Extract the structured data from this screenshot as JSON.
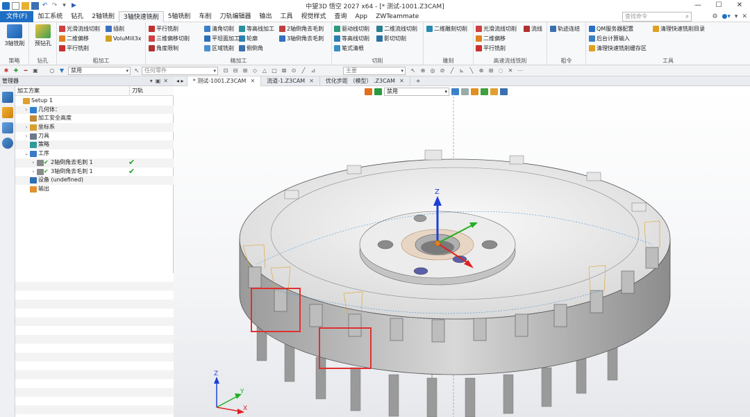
{
  "app": {
    "title": "中望3D 悟空 2027 x64  - [* 测试-1001.Z3CAM]",
    "window_controls": [
      "—",
      "☐",
      "✕"
    ]
  },
  "menu": {
    "tabs": [
      "文件(F)",
      "加工系统",
      "钻孔",
      "2轴铣削",
      "3轴快速铣削",
      "5轴铣削",
      "车削",
      "刀轨编辑器",
      "输出",
      "工具",
      "视觉样式",
      "查询",
      "App",
      "ZWTeammate"
    ],
    "active_tab": "3轴快速铣削",
    "search_placeholder": "查找命令"
  },
  "ribbon": {
    "groups": [
      {
        "label": "策略",
        "items": [
          "3轴铣削"
        ]
      },
      {
        "label": "钻孔",
        "items": [
          "预钻孔"
        ]
      },
      {
        "label": "粗加工",
        "items": [
          "光滑流线切削",
          "二维偏移",
          "平行铣削",
          "插削",
          "VoluMill3x"
        ]
      },
      {
        "label": "精加工",
        "items": [
          "平行铣削",
          "三维偏移切削",
          "角度限制",
          "清角切削",
          "平坦面加工",
          "区域铣削",
          "等高线加工",
          "轮廓",
          "侧倒角",
          "2轴倒角去毛刺",
          "3轴倒角去毛刺"
        ]
      },
      {
        "label": "切削",
        "items": [
          "驱动线切削",
          "等高线切削",
          "笔式清根",
          "二维流线切削",
          "影切切削"
        ]
      },
      {
        "label": "雕刻",
        "items": [
          "二维雕刻切削"
        ]
      },
      {
        "label": "高速流线铣削",
        "items": [
          "光滑流线切削",
          "二维偏移",
          "平行铣削",
          "流线"
        ]
      },
      {
        "label": "粗令",
        "items": [
          "轨迹连结"
        ]
      },
      {
        "label": "工具",
        "items": [
          "QM服务器配置",
          "后台计算输入",
          "清理快速铣削缓存区",
          "清理快速铣削目录"
        ]
      }
    ]
  },
  "filter_bar": {
    "filter_value": "禁用",
    "any_part": "任何零件",
    "main_value": "主要"
  },
  "panel": {
    "title": "管理器",
    "columns": [
      "加工方案",
      "刀轨"
    ],
    "tree": [
      {
        "label": "Setup 1",
        "indent": 0,
        "arrow": "",
        "color": "#e0a030",
        "check": false
      },
      {
        "label": "几何体：",
        "indent": 1,
        "arrow": "›",
        "color": "#2f7fd0",
        "check": false
      },
      {
        "label": "加工安全高度",
        "indent": 1,
        "arrow": "",
        "color": "#c08a3a",
        "check": false
      },
      {
        "label": "坐标系",
        "indent": 1,
        "arrow": "›",
        "color": "#d8a030",
        "check": false
      },
      {
        "label": "刀具",
        "indent": 1,
        "arrow": "›",
        "color": "#6b7a8a",
        "check": false
      },
      {
        "label": "策略",
        "indent": 1,
        "arrow": "",
        "color": "#2e9a9a",
        "check": false
      },
      {
        "label": "工序",
        "indent": 1,
        "arrow": "⌄",
        "color": "#3a79c8",
        "check": false
      },
      {
        "label": "2轴倒角去毛刺 1",
        "indent": 2,
        "arrow": "›",
        "color": "#8a8a8a",
        "check": true
      },
      {
        "label": "3轴倒角去毛刺 1",
        "indent": 2,
        "arrow": "›",
        "color": "#8a8a8a",
        "check": true
      },
      {
        "label": "设备 (undefined)",
        "indent": 1,
        "arrow": "",
        "color": "#2f6fb0",
        "check": false
      },
      {
        "label": "输出",
        "indent": 1,
        "arrow": "",
        "color": "#e09030",
        "check": false
      }
    ]
  },
  "doc_tabs": [
    {
      "label": "* 测试-1001.Z3CAM",
      "active": true
    },
    {
      "label": "流道-1.Z3CAM",
      "active": false
    },
    {
      "label": "优化步距 （模型） .Z3CAM",
      "active": false
    }
  ],
  "viewport": {
    "filter_value": "禁用",
    "axis_labels": {
      "z": "Z",
      "x": "X",
      "y": "Y"
    },
    "colors": {
      "z_axis": "#1d3fd6",
      "x_axis": "#e02020",
      "y_axis": "#20b020",
      "highlight": "#e03030"
    }
  }
}
